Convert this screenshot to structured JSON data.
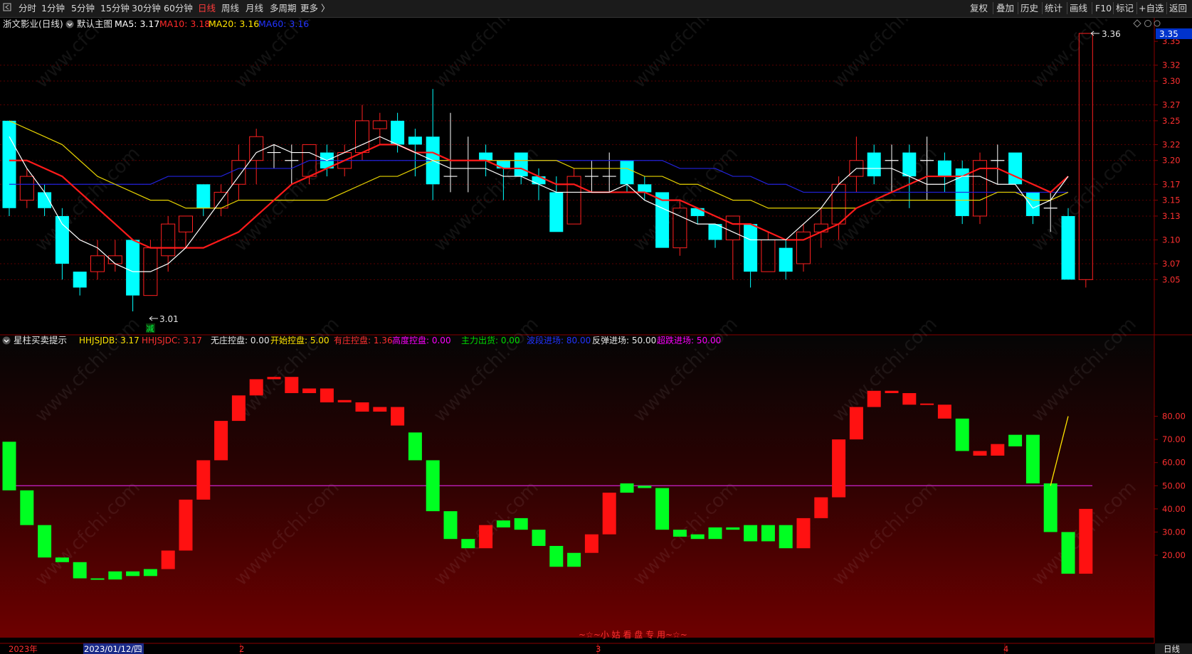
{
  "toolbar": {
    "back_icon": "back-arrow-icon",
    "periods": [
      "分时",
      "1分钟",
      "5分钟",
      "15分钟",
      "30分钟",
      "60分钟",
      "日线",
      "周线",
      "月线",
      "多周期",
      "更多 〉"
    ],
    "active_period": "日线",
    "tools": [
      "复权",
      "叠加",
      "历史",
      "统计",
      "画线",
      "F10",
      "标记",
      "+自选",
      "返回"
    ]
  },
  "main_chart": {
    "stock_title": "浙文影业(日线)",
    "template_label": "默认主图",
    "ma5_label": "MA5: 3.17",
    "ma10_label": "MA10: 3.18",
    "ma20_label": "MA20: 3.16",
    "ma60_label": "MA60: 3.16",
    "price_ticks": [
      "3.35",
      "3.32",
      "3.30",
      "3.27",
      "3.25",
      "3.22",
      "3.20",
      "3.17",
      "3.15",
      "3.13",
      "3.10",
      "3.07",
      "3.05"
    ],
    "current_price_badge": "3.35",
    "high_marker": "3.36",
    "low_marker": "3.01",
    "reduce_badge": "减",
    "right_icons": [
      "diamond-icon",
      "circle-icon",
      "settings-icon"
    ]
  },
  "sub_chart": {
    "indicator_name": "星柱买卖提示",
    "labels": [
      {
        "text": "HHJSJDB: 3.17",
        "color": "#ffe400"
      },
      {
        "text": "HHJSJDC: 3.17",
        "color": "#ff3030"
      },
      {
        "text": "无庄控盘: 0.00",
        "color": "#e6e6e6"
      },
      {
        "text": "开始控盘: 5.00",
        "color": "#ffe400"
      },
      {
        "text": "有庄控盘: 1.36",
        "color": "#ff3030"
      },
      {
        "text": "高度控盘: 0.00",
        "color": "#ff00ff"
      },
      {
        "text": "主力出货: 0.00",
        "color": "#00dd00"
      },
      {
        "text": "波段进场: 80.00",
        "color": "#2233ff"
      },
      {
        "text": "反弹进场: 50.00",
        "color": "#e6e6e6"
      },
      {
        "text": "超跌进场: 50.00",
        "color": "#ff00ff"
      }
    ],
    "y_ticks": [
      "80.00",
      "70.00",
      "60.00",
      "50.00",
      "40.00",
      "30.00",
      "20.00"
    ],
    "watermark_text": "~☆~小 姑 看 盘 专 用~☆~"
  },
  "date_axis": {
    "labels": [
      "2023年",
      "2023/01/12/四",
      "2",
      "3",
      "4"
    ],
    "period_label": "日线"
  },
  "watermark": "www.cfchi.com",
  "colors": {
    "up": "#ff2020",
    "down": "#00ffff",
    "ma5": "#ffffff",
    "ma10": "#ff1a1a",
    "ma20": "#e6d200",
    "ma60": "#2222dd",
    "green_bar": "#00ff22",
    "red_bar": "#ff1111"
  },
  "chart_data": [
    {
      "type": "candlestick",
      "title": "浙文影业(日线)",
      "ylim": [
        3.01,
        3.36
      ],
      "candles": [
        {
          "o": 3.25,
          "c": 3.14,
          "h": 3.25,
          "l": 3.13
        },
        {
          "o": 3.15,
          "c": 3.18,
          "h": 3.19,
          "l": 3.14
        },
        {
          "o": 3.16,
          "c": 3.14,
          "h": 3.17,
          "l": 3.13
        },
        {
          "o": 3.13,
          "c": 3.07,
          "h": 3.14,
          "l": 3.05
        },
        {
          "o": 3.06,
          "c": 3.04,
          "h": 3.06,
          "l": 3.03
        },
        {
          "o": 3.06,
          "c": 3.08,
          "h": 3.1,
          "l": 3.05
        },
        {
          "o": 3.07,
          "c": 3.08,
          "h": 3.1,
          "l": 3.06
        },
        {
          "o": 3.1,
          "c": 3.03,
          "h": 3.1,
          "l": 3.01
        },
        {
          "o": 3.03,
          "c": 3.09,
          "h": 3.1,
          "l": 3.03
        },
        {
          "o": 3.08,
          "c": 3.12,
          "h": 3.13,
          "l": 3.06
        },
        {
          "o": 3.11,
          "c": 3.13,
          "h": 3.13,
          "l": 3.09
        },
        {
          "o": 3.17,
          "c": 3.14,
          "h": 3.17,
          "l": 3.13
        },
        {
          "o": 3.14,
          "c": 3.16,
          "h": 3.17,
          "l": 3.13
        },
        {
          "o": 3.17,
          "c": 3.2,
          "h": 3.22,
          "l": 3.15
        },
        {
          "o": 3.2,
          "c": 3.23,
          "h": 3.24,
          "l": 3.17
        },
        {
          "o": 3.21,
          "c": 3.21,
          "h": 3.22,
          "l": 3.19
        },
        {
          "o": 3.2,
          "c": 3.2,
          "h": 3.22,
          "l": 3.17
        },
        {
          "o": 3.18,
          "c": 3.22,
          "h": 3.22,
          "l": 3.17
        },
        {
          "o": 3.21,
          "c": 3.19,
          "h": 3.22,
          "l": 3.18
        },
        {
          "o": 3.19,
          "c": 3.21,
          "h": 3.22,
          "l": 3.18
        },
        {
          "o": 3.21,
          "c": 3.25,
          "h": 3.27,
          "l": 3.2
        },
        {
          "o": 3.24,
          "c": 3.25,
          "h": 3.26,
          "l": 3.22
        },
        {
          "o": 3.25,
          "c": 3.22,
          "h": 3.26,
          "l": 3.21
        },
        {
          "o": 3.23,
          "c": 3.22,
          "h": 3.24,
          "l": 3.18
        },
        {
          "o": 3.23,
          "c": 3.17,
          "h": 3.29,
          "l": 3.15
        },
        {
          "o": 3.18,
          "c": 3.18,
          "h": 3.26,
          "l": 3.16
        },
        {
          "o": 3.2,
          "c": 3.2,
          "h": 3.23,
          "l": 3.16
        },
        {
          "o": 3.21,
          "c": 3.2,
          "h": 3.22,
          "l": 3.18
        },
        {
          "o": 3.2,
          "c": 3.19,
          "h": 3.2,
          "l": 3.15
        },
        {
          "o": 3.21,
          "c": 3.18,
          "h": 3.21,
          "l": 3.17
        },
        {
          "o": 3.18,
          "c": 3.17,
          "h": 3.19,
          "l": 3.15
        },
        {
          "o": 3.16,
          "c": 3.11,
          "h": 3.18,
          "l": 3.11
        },
        {
          "o": 3.12,
          "c": 3.18,
          "h": 3.19,
          "l": 3.12
        },
        {
          "o": 3.18,
          "c": 3.18,
          "h": 3.2,
          "l": 3.16
        },
        {
          "o": 3.18,
          "c": 3.18,
          "h": 3.21,
          "l": 3.16
        },
        {
          "o": 3.2,
          "c": 3.17,
          "h": 3.2,
          "l": 3.16
        },
        {
          "o": 3.17,
          "c": 3.16,
          "h": 3.18,
          "l": 3.15
        },
        {
          "o": 3.16,
          "c": 3.09,
          "h": 3.16,
          "l": 3.09
        },
        {
          "o": 3.09,
          "c": 3.14,
          "h": 3.15,
          "l": 3.08
        },
        {
          "o": 3.14,
          "c": 3.13,
          "h": 3.14,
          "l": 3.12
        },
        {
          "o": 3.12,
          "c": 3.1,
          "h": 3.12,
          "l": 3.09
        },
        {
          "o": 3.1,
          "c": 3.13,
          "h": 3.13,
          "l": 3.05
        },
        {
          "o": 3.12,
          "c": 3.06,
          "h": 3.12,
          "l": 3.04
        },
        {
          "o": 3.06,
          "c": 3.1,
          "h": 3.11,
          "l": 3.06
        },
        {
          "o": 3.09,
          "c": 3.06,
          "h": 3.1,
          "l": 3.05
        },
        {
          "o": 3.07,
          "c": 3.11,
          "h": 3.12,
          "l": 3.06
        },
        {
          "o": 3.11,
          "c": 3.12,
          "h": 3.14,
          "l": 3.09
        },
        {
          "o": 3.12,
          "c": 3.17,
          "h": 3.18,
          "l": 3.1
        },
        {
          "o": 3.18,
          "c": 3.2,
          "h": 3.23,
          "l": 3.16
        },
        {
          "o": 3.21,
          "c": 3.18,
          "h": 3.22,
          "l": 3.17
        },
        {
          "o": 3.2,
          "c": 3.2,
          "h": 3.22,
          "l": 3.16
        },
        {
          "o": 3.21,
          "c": 3.18,
          "h": 3.22,
          "l": 3.14
        },
        {
          "o": 3.2,
          "c": 3.2,
          "h": 3.23,
          "l": 3.15
        },
        {
          "o": 3.2,
          "c": 3.18,
          "h": 3.21,
          "l": 3.16
        },
        {
          "o": 3.19,
          "c": 3.13,
          "h": 3.2,
          "l": 3.12
        },
        {
          "o": 3.13,
          "c": 3.2,
          "h": 3.21,
          "l": 3.12
        },
        {
          "o": 3.2,
          "c": 3.2,
          "h": 3.22,
          "l": 3.17
        },
        {
          "o": 3.21,
          "c": 3.17,
          "h": 3.21,
          "l": 3.17
        },
        {
          "o": 3.16,
          "c": 3.13,
          "h": 3.16,
          "l": 3.12
        },
        {
          "o": 3.14,
          "c": 3.14,
          "h": 3.16,
          "l": 3.11
        },
        {
          "o": 3.13,
          "c": 3.05,
          "h": 3.14,
          "l": 3.05
        },
        {
          "o": 3.05,
          "c": 3.36,
          "h": 3.36,
          "l": 3.04
        }
      ],
      "ma5": [
        3.23,
        3.19,
        3.16,
        3.12,
        3.1,
        3.09,
        3.07,
        3.06,
        3.06,
        3.07,
        3.09,
        3.12,
        3.15,
        3.18,
        3.21,
        3.22,
        3.21,
        3.21,
        3.2,
        3.21,
        3.22,
        3.23,
        3.22,
        3.21,
        3.2,
        3.19,
        3.19,
        3.19,
        3.18,
        3.18,
        3.17,
        3.16,
        3.16,
        3.16,
        3.16,
        3.17,
        3.15,
        3.14,
        3.13,
        3.12,
        3.12,
        3.11,
        3.1,
        3.1,
        3.1,
        3.12,
        3.14,
        3.17,
        3.19,
        3.19,
        3.19,
        3.18,
        3.17,
        3.17,
        3.18,
        3.18,
        3.17,
        3.17,
        3.14,
        3.15,
        3.18
      ],
      "ma10": [
        3.2,
        3.2,
        3.19,
        3.18,
        3.16,
        3.14,
        3.12,
        3.1,
        3.09,
        3.09,
        3.09,
        3.09,
        3.1,
        3.11,
        3.13,
        3.15,
        3.17,
        3.18,
        3.19,
        3.2,
        3.21,
        3.22,
        3.22,
        3.21,
        3.21,
        3.2,
        3.2,
        3.2,
        3.19,
        3.19,
        3.18,
        3.17,
        3.17,
        3.16,
        3.16,
        3.16,
        3.16,
        3.15,
        3.15,
        3.14,
        3.13,
        3.12,
        3.12,
        3.11,
        3.1,
        3.1,
        3.11,
        3.12,
        3.14,
        3.15,
        3.16,
        3.17,
        3.18,
        3.18,
        3.18,
        3.19,
        3.19,
        3.18,
        3.17,
        3.16,
        3.18
      ],
      "ma20": [
        3.25,
        3.24,
        3.23,
        3.22,
        3.2,
        3.18,
        3.17,
        3.16,
        3.15,
        3.15,
        3.14,
        3.14,
        3.14,
        3.15,
        3.15,
        3.15,
        3.15,
        3.15,
        3.15,
        3.16,
        3.17,
        3.18,
        3.18,
        3.19,
        3.2,
        3.2,
        3.2,
        3.2,
        3.2,
        3.2,
        3.2,
        3.2,
        3.19,
        3.19,
        3.19,
        3.19,
        3.18,
        3.18,
        3.17,
        3.17,
        3.16,
        3.15,
        3.15,
        3.14,
        3.14,
        3.14,
        3.14,
        3.14,
        3.14,
        3.15,
        3.15,
        3.15,
        3.15,
        3.15,
        3.15,
        3.15,
        3.16,
        3.16,
        3.15,
        3.15,
        3.16
      ],
      "ma60": [
        3.17,
        3.17,
        3.17,
        3.17,
        3.17,
        3.17,
        3.17,
        3.17,
        3.17,
        3.18,
        3.18,
        3.18,
        3.18,
        3.19,
        3.19,
        3.19,
        3.19,
        3.2,
        3.2,
        3.2,
        3.2,
        3.2,
        3.2,
        3.2,
        3.2,
        3.2,
        3.2,
        3.2,
        3.2,
        3.2,
        3.2,
        3.2,
        3.2,
        3.2,
        3.2,
        3.2,
        3.2,
        3.2,
        3.19,
        3.19,
        3.19,
        3.18,
        3.18,
        3.17,
        3.17,
        3.16,
        3.16,
        3.16,
        3.16,
        3.16,
        3.16,
        3.16,
        3.16,
        3.16,
        3.16,
        3.16,
        3.16,
        3.16,
        3.16,
        3.16,
        3.16
      ]
    },
    {
      "type": "bar",
      "title": "星柱买卖提示",
      "ylim": [
        0,
        100
      ],
      "bars": [
        {
          "from": 48,
          "to": 69,
          "color": "green"
        },
        {
          "from": 33,
          "to": 48,
          "color": "green"
        },
        {
          "from": 19,
          "to": 33,
          "color": "green"
        },
        {
          "from": 17,
          "to": 19,
          "color": "green"
        },
        {
          "from": 10,
          "to": 17,
          "color": "green"
        },
        {
          "from": 9.5,
          "to": 10,
          "color": "green"
        },
        {
          "from": 9.5,
          "to": 13,
          "color": "green"
        },
        {
          "from": 11,
          "to": 13,
          "color": "green"
        },
        {
          "from": 11,
          "to": 14,
          "color": "green"
        },
        {
          "from": 14,
          "to": 22,
          "color": "red"
        },
        {
          "from": 22,
          "to": 44,
          "color": "red"
        },
        {
          "from": 44,
          "to": 61,
          "color": "red"
        },
        {
          "from": 61,
          "to": 78,
          "color": "red"
        },
        {
          "from": 78,
          "to": 89,
          "color": "red"
        },
        {
          "from": 89,
          "to": 96,
          "color": "red"
        },
        {
          "from": 96,
          "to": 97,
          "color": "red"
        },
        {
          "from": 90,
          "to": 97,
          "color": "red"
        },
        {
          "from": 90,
          "to": 92,
          "color": "red"
        },
        {
          "from": 86,
          "to": 92,
          "color": "red"
        },
        {
          "from": 86,
          "to": 87,
          "color": "red"
        },
        {
          "from": 82,
          "to": 86,
          "color": "red"
        },
        {
          "from": 82,
          "to": 84,
          "color": "red"
        },
        {
          "from": 76,
          "to": 84,
          "color": "red"
        },
        {
          "from": 61,
          "to": 73,
          "color": "green"
        },
        {
          "from": 39,
          "to": 61,
          "color": "green"
        },
        {
          "from": 27,
          "to": 39,
          "color": "green"
        },
        {
          "from": 23,
          "to": 27,
          "color": "green"
        },
        {
          "from": 23,
          "to": 33,
          "color": "red"
        },
        {
          "from": 32,
          "to": 35,
          "color": "green"
        },
        {
          "from": 31,
          "to": 36,
          "color": "green"
        },
        {
          "from": 24,
          "to": 31,
          "color": "green"
        },
        {
          "from": 15,
          "to": 24,
          "color": "green"
        },
        {
          "from": 15,
          "to": 21,
          "color": "green"
        },
        {
          "from": 21,
          "to": 29,
          "color": "red"
        },
        {
          "from": 29,
          "to": 47,
          "color": "red"
        },
        {
          "from": 47,
          "to": 51,
          "color": "green"
        },
        {
          "from": 49,
          "to": 50,
          "color": "green"
        },
        {
          "from": 31,
          "to": 49,
          "color": "green"
        },
        {
          "from": 28,
          "to": 31,
          "color": "green"
        },
        {
          "from": 27,
          "to": 29,
          "color": "green"
        },
        {
          "from": 27,
          "to": 32,
          "color": "green"
        },
        {
          "from": 31,
          "to": 32,
          "color": "green"
        },
        {
          "from": 26,
          "to": 33,
          "color": "green"
        },
        {
          "from": 26,
          "to": 33,
          "color": "green"
        },
        {
          "from": 23,
          "to": 33,
          "color": "green"
        },
        {
          "from": 23,
          "to": 36,
          "color": "red"
        },
        {
          "from": 36,
          "to": 45,
          "color": "red"
        },
        {
          "from": 45,
          "to": 70,
          "color": "red"
        },
        {
          "from": 70,
          "to": 84,
          "color": "red"
        },
        {
          "from": 84,
          "to": 91,
          "color": "red"
        },
        {
          "from": 90,
          "to": 91,
          "color": "red"
        },
        {
          "from": 85,
          "to": 90,
          "color": "red"
        },
        {
          "from": 85,
          "to": 85.5,
          "color": "red"
        },
        {
          "from": 79,
          "to": 85,
          "color": "red"
        },
        {
          "from": 65,
          "to": 79,
          "color": "green"
        },
        {
          "from": 63,
          "to": 65,
          "color": "red"
        },
        {
          "from": 63,
          "to": 68,
          "color": "red"
        },
        {
          "from": 67,
          "to": 72,
          "color": "green"
        },
        {
          "from": 51,
          "to": 72,
          "color": "green"
        },
        {
          "from": 30,
          "to": 51,
          "color": "green"
        },
        {
          "from": 12,
          "to": 30,
          "color": "green"
        },
        {
          "from": 12,
          "to": 40,
          "color": "red"
        }
      ],
      "reference_line": 50,
      "yellow_line": [
        {
          "x": 59,
          "y": 50
        },
        {
          "x": 60,
          "y": 80
        }
      ]
    }
  ]
}
